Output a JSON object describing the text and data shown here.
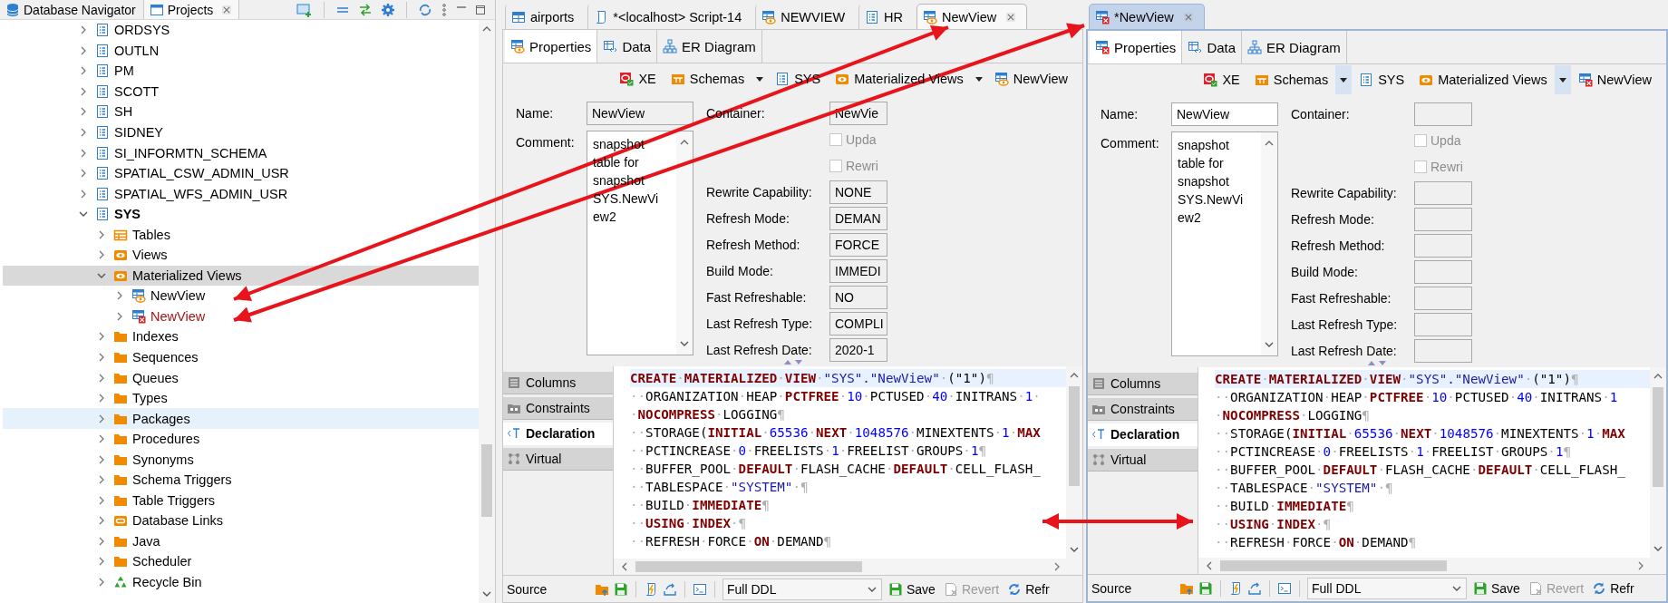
{
  "navigator": {
    "tabs": [
      {
        "label": "Database Navigator",
        "kind": "database",
        "selected": false
      },
      {
        "label": "Projects",
        "kind": "projects",
        "selected": true
      }
    ],
    "tree": [
      {
        "label": "ORDSYS",
        "kind": "schema",
        "expanded": false,
        "active": false,
        "selected": false
      },
      {
        "label": "OUTLN",
        "kind": "schema",
        "expanded": false,
        "active": false,
        "selected": false
      },
      {
        "label": "PM",
        "kind": "schema",
        "expanded": false,
        "active": false,
        "selected": false
      },
      {
        "label": "SCOTT",
        "kind": "schema",
        "expanded": false,
        "active": false,
        "selected": false
      },
      {
        "label": "SH",
        "kind": "schema",
        "expanded": false,
        "active": false,
        "selected": false
      },
      {
        "label": "SIDNEY",
        "kind": "schema",
        "expanded": false,
        "active": false,
        "selected": false
      },
      {
        "label": "SI_INFORMTN_SCHEMA",
        "kind": "schema",
        "expanded": false,
        "active": false,
        "selected": false
      },
      {
        "label": "SPATIAL_CSW_ADMIN_USR",
        "kind": "schema",
        "expanded": false,
        "active": false,
        "selected": false
      },
      {
        "label": "SPATIAL_WFS_ADMIN_USR",
        "kind": "schema",
        "expanded": false,
        "active": false,
        "selected": false
      },
      {
        "label": "SYS",
        "kind": "schema",
        "expanded": true,
        "active": true,
        "selected": false,
        "children": [
          {
            "label": "Tables",
            "kind": "tables",
            "expanded": false,
            "selected": false,
            "hovered": false
          },
          {
            "label": "Views",
            "kind": "views",
            "expanded": false,
            "selected": false,
            "hovered": false
          },
          {
            "label": "Materialized Views",
            "kind": "views",
            "expanded": true,
            "selected": true,
            "hovered": false,
            "children": [
              {
                "label": "NewView",
                "kind": "mview",
                "expanded": false,
                "selected": false,
                "error": false
              },
              {
                "label": "NewView",
                "kind": "mview-invalid",
                "expanded": false,
                "selected": false,
                "error": true
              }
            ]
          },
          {
            "label": "Indexes",
            "kind": "folder",
            "expanded": false,
            "selected": false,
            "hovered": false
          },
          {
            "label": "Sequences",
            "kind": "folder",
            "expanded": false,
            "selected": false,
            "hovered": false
          },
          {
            "label": "Queues",
            "kind": "folder",
            "expanded": false,
            "selected": false,
            "hovered": false
          },
          {
            "label": "Types",
            "kind": "folder",
            "expanded": false,
            "selected": false,
            "hovered": false
          },
          {
            "label": "Packages",
            "kind": "folder",
            "expanded": false,
            "selected": false,
            "hovered": true
          },
          {
            "label": "Procedures",
            "kind": "folder",
            "expanded": false,
            "selected": false,
            "hovered": false
          },
          {
            "label": "Synonyms",
            "kind": "folder",
            "expanded": false,
            "selected": false,
            "hovered": false
          },
          {
            "label": "Schema Triggers",
            "kind": "folder",
            "expanded": false,
            "selected": false,
            "hovered": false
          },
          {
            "label": "Table Triggers",
            "kind": "folder",
            "expanded": false,
            "selected": false,
            "hovered": false
          },
          {
            "label": "Database Links",
            "kind": "dblinks",
            "expanded": false,
            "selected": false,
            "hovered": false
          },
          {
            "label": "Java",
            "kind": "folder",
            "expanded": false,
            "selected": false,
            "hovered": false
          },
          {
            "label": "Scheduler",
            "kind": "folder",
            "expanded": false,
            "selected": false,
            "hovered": false
          },
          {
            "label": "Recycle Bin",
            "kind": "recycle",
            "expanded": false,
            "selected": false,
            "hovered": false
          }
        ]
      }
    ]
  },
  "editors": [
    {
      "active": false,
      "tabs": [
        {
          "label": "airports",
          "kind": "table",
          "selected": false
        },
        {
          "label": "*<localhost> Script-14",
          "kind": "script",
          "selected": false
        },
        {
          "label": "NEWVIEW",
          "kind": "mview",
          "selected": false
        },
        {
          "label": "HR",
          "kind": "schema",
          "selected": false
        },
        {
          "label": "NewView",
          "kind": "mview",
          "selected": true
        }
      ],
      "subtabs": [
        {
          "label": "Properties",
          "kind": "mview",
          "selected": true
        },
        {
          "label": "Data",
          "kind": "data",
          "selected": false
        },
        {
          "label": "ER Diagram",
          "kind": "er",
          "selected": false
        }
      ],
      "breadcrumb": [
        {
          "label": "XE",
          "kind": "connection"
        },
        {
          "label": "Schemas",
          "kind": "schemas",
          "dropdown": true
        },
        {
          "label": "SYS",
          "kind": "schema"
        },
        {
          "label": "Materialized Views",
          "kind": "views",
          "dropdown": true
        },
        {
          "label": "NewView",
          "kind": "mview"
        }
      ],
      "form": {
        "name": {
          "label": "Name:",
          "value": "NewView",
          "read_only": true
        },
        "comment": {
          "label": "Comment:",
          "value": "snapshot table for snapshot SYS.NewView2"
        },
        "container": {
          "label": "Container:",
          "value": "NewVie"
        },
        "options": [
          {
            "label": "Upda",
            "checked": false,
            "disabled": true
          },
          {
            "label": "Rewri",
            "checked": false,
            "disabled": true
          }
        ],
        "properties": [
          {
            "label": "Rewrite Capability:",
            "value": "NONE"
          },
          {
            "label": "Refresh Mode:",
            "value": "DEMAN"
          },
          {
            "label": "Refresh Method:",
            "value": "FORCE"
          },
          {
            "label": "Build Mode:",
            "value": "IMMEDI"
          },
          {
            "label": "Fast Refreshable:",
            "value": "NO"
          },
          {
            "label": "Last Refresh Type:",
            "value": "COMPLI"
          },
          {
            "label": "Last Refresh Date:",
            "value": "2020-1"
          }
        ]
      },
      "sections": [
        {
          "label": "Columns",
          "kind": "columns",
          "selected": false
        },
        {
          "label": "Constraints",
          "kind": "constraints",
          "selected": false
        },
        {
          "label": "Declaration",
          "kind": "declaration",
          "selected": true
        },
        {
          "label": "Virtual",
          "kind": "virtual",
          "selected": false
        }
      ],
      "code_lines": [
        {
          "current": true,
          "tokens": [
            {
              "text": "CREATE",
              "kind": "keyword"
            },
            {
              "text": "·",
              "kind": "space"
            },
            {
              "text": "MATERIALIZED",
              "kind": "keyword"
            },
            {
              "text": "·",
              "kind": "space"
            },
            {
              "text": "VIEW",
              "kind": "keyword"
            },
            {
              "text": "·",
              "kind": "space"
            },
            {
              "text": "\"SYS\".\"NewView\"",
              "kind": "string"
            },
            {
              "text": "·",
              "kind": "space"
            },
            {
              "text": "(\"1\")",
              "kind": "plain"
            },
            {
              "text": "¶",
              "kind": "space"
            }
          ]
        },
        {
          "current": false,
          "tokens": [
            {
              "text": "··",
              "kind": "space"
            },
            {
              "text": "ORGANIZATION",
              "kind": "plain"
            },
            {
              "text": "·",
              "kind": "space"
            },
            {
              "text": "HEAP",
              "kind": "plain"
            },
            {
              "text": "·",
              "kind": "space"
            },
            {
              "text": "PCTFREE",
              "kind": "keyword"
            },
            {
              "text": "·",
              "kind": "space"
            },
            {
              "text": "10",
              "kind": "number"
            },
            {
              "text": "·",
              "kind": "space"
            },
            {
              "text": "PCTUSED",
              "kind": "plain"
            },
            {
              "text": "·",
              "kind": "space"
            },
            {
              "text": "40",
              "kind": "number"
            },
            {
              "text": "·",
              "kind": "space"
            },
            {
              "text": "INITRANS",
              "kind": "plain"
            },
            {
              "text": "·",
              "kind": "space"
            },
            {
              "text": "1",
              "kind": "number"
            },
            {
              "text": "·",
              "kind": "space"
            }
          ]
        },
        {
          "current": false,
          "tokens": [
            {
              "text": "·",
              "kind": "space"
            },
            {
              "text": "NOCOMPRESS",
              "kind": "keyword"
            },
            {
              "text": "·",
              "kind": "space"
            },
            {
              "text": "LOGGING",
              "kind": "plain"
            },
            {
              "text": "¶",
              "kind": "space"
            }
          ]
        },
        {
          "current": false,
          "tokens": [
            {
              "text": "··",
              "kind": "space"
            },
            {
              "text": "STORAGE(",
              "kind": "plain"
            },
            {
              "text": "INITIAL",
              "kind": "keyword"
            },
            {
              "text": "·",
              "kind": "space"
            },
            {
              "text": "65536",
              "kind": "number"
            },
            {
              "text": "·",
              "kind": "space"
            },
            {
              "text": "NEXT",
              "kind": "keyword"
            },
            {
              "text": "·",
              "kind": "space"
            },
            {
              "text": "1048576",
              "kind": "number"
            },
            {
              "text": "·",
              "kind": "space"
            },
            {
              "text": "MINEXTENTS",
              "kind": "plain"
            },
            {
              "text": "·",
              "kind": "space"
            },
            {
              "text": "1",
              "kind": "number"
            },
            {
              "text": "·",
              "kind": "space"
            },
            {
              "text": "MAX",
              "kind": "keyword"
            }
          ]
        },
        {
          "current": false,
          "tokens": [
            {
              "text": "··",
              "kind": "space"
            },
            {
              "text": "PCTINCREASE",
              "kind": "plain"
            },
            {
              "text": "·",
              "kind": "space"
            },
            {
              "text": "0",
              "kind": "number"
            },
            {
              "text": "·",
              "kind": "space"
            },
            {
              "text": "FREELISTS",
              "kind": "plain"
            },
            {
              "text": "·",
              "kind": "space"
            },
            {
              "text": "1",
              "kind": "number"
            },
            {
              "text": "·",
              "kind": "space"
            },
            {
              "text": "FREELIST",
              "kind": "plain"
            },
            {
              "text": "·",
              "kind": "space"
            },
            {
              "text": "GROUPS",
              "kind": "plain"
            },
            {
              "text": "·",
              "kind": "space"
            },
            {
              "text": "1",
              "kind": "number"
            },
            {
              "text": "¶",
              "kind": "space"
            }
          ]
        },
        {
          "current": false,
          "tokens": [
            {
              "text": "··",
              "kind": "space"
            },
            {
              "text": "BUFFER_POOL",
              "kind": "plain"
            },
            {
              "text": "·",
              "kind": "space"
            },
            {
              "text": "DEFAULT",
              "kind": "keyword"
            },
            {
              "text": "·",
              "kind": "space"
            },
            {
              "text": "FLASH_CACHE",
              "kind": "plain"
            },
            {
              "text": "·",
              "kind": "space"
            },
            {
              "text": "DEFAULT",
              "kind": "keyword"
            },
            {
              "text": "·",
              "kind": "space"
            },
            {
              "text": "CELL_FLASH_",
              "kind": "plain"
            }
          ]
        },
        {
          "current": false,
          "tokens": [
            {
              "text": "··",
              "kind": "space"
            },
            {
              "text": "TABLESPACE",
              "kind": "plain"
            },
            {
              "text": "·",
              "kind": "space"
            },
            {
              "text": "\"SYSTEM\"",
              "kind": "string"
            },
            {
              "text": "·¶",
              "kind": "space"
            }
          ]
        },
        {
          "current": false,
          "tokens": [
            {
              "text": "··",
              "kind": "space"
            },
            {
              "text": "BUILD",
              "kind": "plain"
            },
            {
              "text": "·",
              "kind": "space"
            },
            {
              "text": "IMMEDIATE",
              "kind": "keyword"
            },
            {
              "text": "¶",
              "kind": "space"
            }
          ]
        },
        {
          "current": false,
          "tokens": [
            {
              "text": "··",
              "kind": "space"
            },
            {
              "text": "USING",
              "kind": "keyword"
            },
            {
              "text": "·",
              "kind": "space"
            },
            {
              "text": "INDEX",
              "kind": "keyword"
            },
            {
              "text": "·¶",
              "kind": "space"
            }
          ]
        },
        {
          "current": false,
          "tokens": [
            {
              "text": "··",
              "kind": "space"
            },
            {
              "text": "REFRESH",
              "kind": "plain"
            },
            {
              "text": "·",
              "kind": "space"
            },
            {
              "text": "FORCE",
              "kind": "plain"
            },
            {
              "text": "·",
              "kind": "space"
            },
            {
              "text": "ON",
              "kind": "keyword"
            },
            {
              "text": "·",
              "kind": "space"
            },
            {
              "text": "DEMAND",
              "kind": "plain"
            },
            {
              "text": "¶",
              "kind": "space"
            }
          ]
        }
      ],
      "toolbar": {
        "label": "Source",
        "format": "Full DDL",
        "buttons": [
          {
            "label": "Save",
            "kind": "save",
            "disabled": false
          },
          {
            "label": "Revert",
            "kind": "revert",
            "disabled": true
          },
          {
            "label": "Refr",
            "kind": "refresh",
            "disabled": false
          }
        ]
      }
    },
    {
      "active": true,
      "tabs": [
        {
          "label": "*NewView",
          "kind": "mview-invalid",
          "selected": true
        }
      ],
      "subtabs": [
        {
          "label": "Properties",
          "kind": "mview-invalid",
          "selected": true
        },
        {
          "label": "Data",
          "kind": "data",
          "selected": false
        },
        {
          "label": "ER Diagram",
          "kind": "er",
          "selected": false
        }
      ],
      "breadcrumb": [
        {
          "label": "XE",
          "kind": "connection"
        },
        {
          "label": "Schemas",
          "kind": "schemas",
          "dropdown": true
        },
        {
          "label": "SYS",
          "kind": "schema"
        },
        {
          "label": "Materialized Views",
          "kind": "views",
          "dropdown": true
        },
        {
          "label": "NewView",
          "kind": "mview-invalid"
        }
      ],
      "form": {
        "name": {
          "label": "Name:",
          "value": "NewView",
          "read_only": false
        },
        "comment": {
          "label": "Comment:",
          "value": "snapshot table for snapshot SYS.NewView2"
        },
        "container": {
          "label": "Container:"
        },
        "options": [
          {
            "label": "Upda",
            "checked": false,
            "disabled": true
          },
          {
            "label": "Rewri",
            "checked": false,
            "disabled": true
          }
        ],
        "properties": [
          {
            "label": "Rewrite Capability:"
          },
          {
            "label": "Refresh Mode:"
          },
          {
            "label": "Refresh Method:"
          },
          {
            "label": "Build Mode:"
          },
          {
            "label": "Fast Refreshable:"
          },
          {
            "label": "Last Refresh Type:"
          },
          {
            "label": "Last Refresh Date:"
          }
        ]
      },
      "sections": [
        {
          "label": "Columns",
          "kind": "columns",
          "selected": false
        },
        {
          "label": "Constraints",
          "kind": "constraints",
          "selected": false
        },
        {
          "label": "Declaration",
          "kind": "declaration",
          "selected": true
        },
        {
          "label": "Virtual",
          "kind": "virtual",
          "selected": false
        }
      ],
      "code_lines": [
        {
          "current": true,
          "tokens": [
            {
              "text": "CREATE",
              "kind": "keyword"
            },
            {
              "text": "·",
              "kind": "space"
            },
            {
              "text": "MATERIALIZED",
              "kind": "keyword"
            },
            {
              "text": "·",
              "kind": "space"
            },
            {
              "text": "VIEW",
              "kind": "keyword"
            },
            {
              "text": "·",
              "kind": "space"
            },
            {
              "text": "\"SYS\".\"NewView\"",
              "kind": "string"
            },
            {
              "text": "·",
              "kind": "space"
            },
            {
              "text": "(\"1\")",
              "kind": "plain"
            },
            {
              "text": "¶",
              "kind": "space"
            }
          ]
        },
        {
          "current": false,
          "tokens": [
            {
              "text": "··",
              "kind": "space"
            },
            {
              "text": "ORGANIZATION",
              "kind": "plain"
            },
            {
              "text": "·",
              "kind": "space"
            },
            {
              "text": "HEAP",
              "kind": "plain"
            },
            {
              "text": "·",
              "kind": "space"
            },
            {
              "text": "PCTFREE",
              "kind": "keyword"
            },
            {
              "text": "·",
              "kind": "space"
            },
            {
              "text": "10",
              "kind": "number"
            },
            {
              "text": "·",
              "kind": "space"
            },
            {
              "text": "PCTUSED",
              "kind": "plain"
            },
            {
              "text": "·",
              "kind": "space"
            },
            {
              "text": "40",
              "kind": "number"
            },
            {
              "text": "·",
              "kind": "space"
            },
            {
              "text": "INITRANS",
              "kind": "plain"
            },
            {
              "text": "·",
              "kind": "space"
            },
            {
              "text": "1",
              "kind": "number"
            }
          ]
        },
        {
          "current": false,
          "tokens": [
            {
              "text": "·",
              "kind": "space"
            },
            {
              "text": "NOCOMPRESS",
              "kind": "keyword"
            },
            {
              "text": "·",
              "kind": "space"
            },
            {
              "text": "LOGGING",
              "kind": "plain"
            },
            {
              "text": "¶",
              "kind": "space"
            }
          ]
        },
        {
          "current": false,
          "tokens": [
            {
              "text": "··",
              "kind": "space"
            },
            {
              "text": "STORAGE(",
              "kind": "plain"
            },
            {
              "text": "INITIAL",
              "kind": "keyword"
            },
            {
              "text": "·",
              "kind": "space"
            },
            {
              "text": "65536",
              "kind": "number"
            },
            {
              "text": "·",
              "kind": "space"
            },
            {
              "text": "NEXT",
              "kind": "keyword"
            },
            {
              "text": "·",
              "kind": "space"
            },
            {
              "text": "1048576",
              "kind": "number"
            },
            {
              "text": "·",
              "kind": "space"
            },
            {
              "text": "MINEXTENTS",
              "kind": "plain"
            },
            {
              "text": "·",
              "kind": "space"
            },
            {
              "text": "1",
              "kind": "number"
            },
            {
              "text": "·",
              "kind": "space"
            },
            {
              "text": "MAX",
              "kind": "keyword"
            }
          ]
        },
        {
          "current": false,
          "tokens": [
            {
              "text": "··",
              "kind": "space"
            },
            {
              "text": "PCTINCREASE",
              "kind": "plain"
            },
            {
              "text": "·",
              "kind": "space"
            },
            {
              "text": "0",
              "kind": "number"
            },
            {
              "text": "·",
              "kind": "space"
            },
            {
              "text": "FREELISTS",
              "kind": "plain"
            },
            {
              "text": "·",
              "kind": "space"
            },
            {
              "text": "1",
              "kind": "number"
            },
            {
              "text": "·",
              "kind": "space"
            },
            {
              "text": "FREELIST",
              "kind": "plain"
            },
            {
              "text": "·",
              "kind": "space"
            },
            {
              "text": "GROUPS",
              "kind": "plain"
            },
            {
              "text": "·",
              "kind": "space"
            },
            {
              "text": "1",
              "kind": "number"
            },
            {
              "text": "¶",
              "kind": "space"
            }
          ]
        },
        {
          "current": false,
          "tokens": [
            {
              "text": "··",
              "kind": "space"
            },
            {
              "text": "BUFFER_POOL",
              "kind": "plain"
            },
            {
              "text": "·",
              "kind": "space"
            },
            {
              "text": "DEFAULT",
              "kind": "keyword"
            },
            {
              "text": "·",
              "kind": "space"
            },
            {
              "text": "FLASH_CACHE",
              "kind": "plain"
            },
            {
              "text": "·",
              "kind": "space"
            },
            {
              "text": "DEFAULT",
              "kind": "keyword"
            },
            {
              "text": "·",
              "kind": "space"
            },
            {
              "text": "CELL_FLASH_",
              "kind": "plain"
            }
          ]
        },
        {
          "current": false,
          "tokens": [
            {
              "text": "··",
              "kind": "space"
            },
            {
              "text": "TABLESPACE",
              "kind": "plain"
            },
            {
              "text": "·",
              "kind": "space"
            },
            {
              "text": "\"SYSTEM\"",
              "kind": "string"
            },
            {
              "text": "·¶",
              "kind": "space"
            }
          ]
        },
        {
          "current": false,
          "tokens": [
            {
              "text": "··",
              "kind": "space"
            },
            {
              "text": "BUILD",
              "kind": "plain"
            },
            {
              "text": "·",
              "kind": "space"
            },
            {
              "text": "IMMEDIATE",
              "kind": "keyword"
            },
            {
              "text": "¶",
              "kind": "space"
            }
          ]
        },
        {
          "current": false,
          "tokens": [
            {
              "text": "··",
              "kind": "space"
            },
            {
              "text": "USING",
              "kind": "keyword"
            },
            {
              "text": "·",
              "kind": "space"
            },
            {
              "text": "INDEX",
              "kind": "keyword"
            },
            {
              "text": "·¶",
              "kind": "space"
            }
          ]
        },
        {
          "current": false,
          "tokens": [
            {
              "text": "··",
              "kind": "space"
            },
            {
              "text": "REFRESH",
              "kind": "plain"
            },
            {
              "text": "·",
              "kind": "space"
            },
            {
              "text": "FORCE",
              "kind": "plain"
            },
            {
              "text": "·",
              "kind": "space"
            },
            {
              "text": "ON",
              "kind": "keyword"
            },
            {
              "text": "·",
              "kind": "space"
            },
            {
              "text": "DEMAND",
              "kind": "plain"
            },
            {
              "text": "¶",
              "kind": "space"
            }
          ]
        }
      ],
      "toolbar": {
        "label": "Source",
        "format": "Full DDL",
        "buttons": [
          {
            "label": "Save",
            "kind": "save",
            "disabled": false
          },
          {
            "label": "Revert",
            "kind": "revert",
            "disabled": true
          },
          {
            "label": "Refr",
            "kind": "refresh",
            "disabled": false
          }
        ]
      }
    }
  ]
}
